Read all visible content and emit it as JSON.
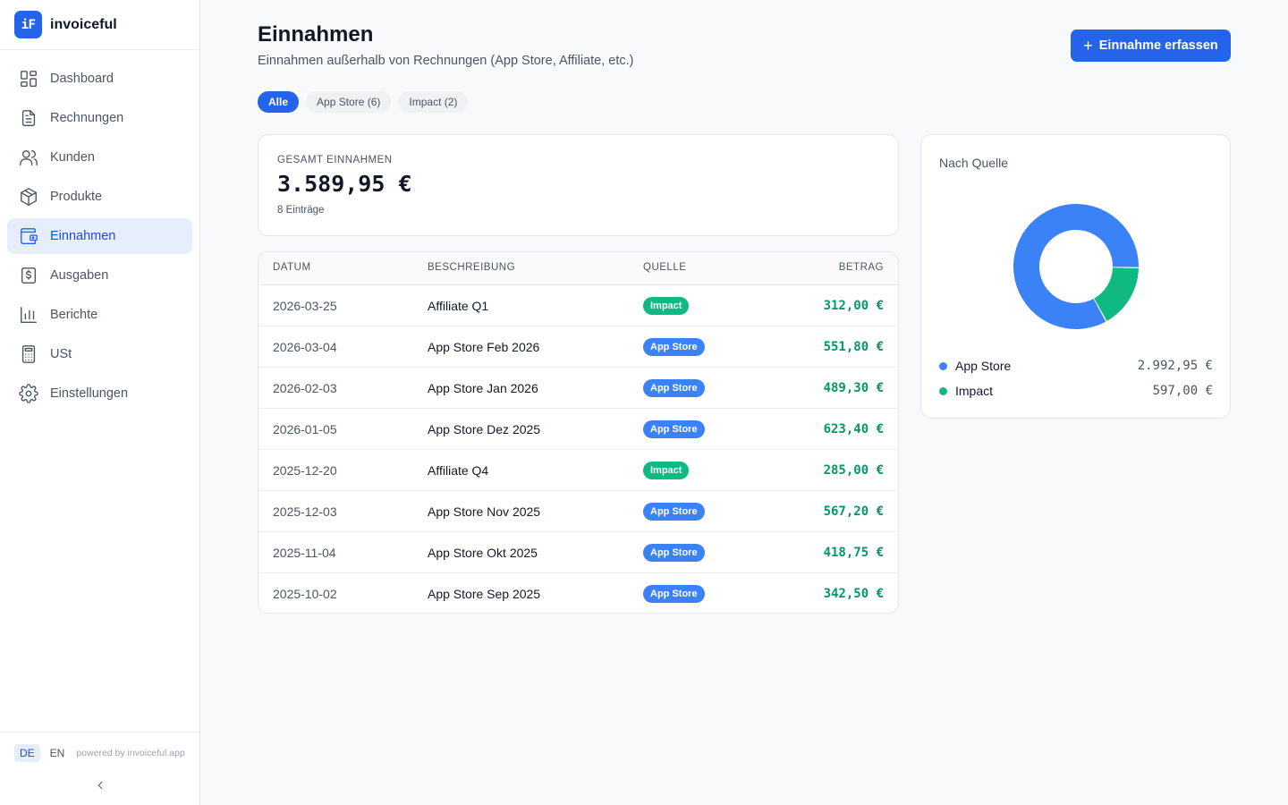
{
  "brand": {
    "logo": "iF",
    "name": "invoiceful"
  },
  "nav": [
    {
      "label": "Dashboard",
      "icon": "dashboard-icon",
      "active": false
    },
    {
      "label": "Rechnungen",
      "icon": "document-icon",
      "active": false
    },
    {
      "label": "Kunden",
      "icon": "users-icon",
      "active": false
    },
    {
      "label": "Produkte",
      "icon": "box-icon",
      "active": false
    },
    {
      "label": "Einnahmen",
      "icon": "wallet-icon",
      "active": true
    },
    {
      "label": "Ausgaben",
      "icon": "receipt-dollar-icon",
      "active": false
    },
    {
      "label": "Berichte",
      "icon": "bar-chart-icon",
      "active": false
    },
    {
      "label": "USt",
      "icon": "calculator-icon",
      "active": false
    },
    {
      "label": "Einstellungen",
      "icon": "gear-icon",
      "active": false
    }
  ],
  "footer": {
    "lang_de": "DE",
    "lang_en": "EN",
    "active_lang": "DE",
    "powered": "powered by invoiceful.app"
  },
  "header": {
    "title": "Einnahmen",
    "subtitle": "Einnahmen außerhalb von Rechnungen (App Store, Affiliate, etc.)",
    "add_button_plus": "+",
    "add_button": "Einnahme erfassen"
  },
  "filters": [
    {
      "label": "Alle",
      "active": true
    },
    {
      "label": "App Store (6)",
      "active": false
    },
    {
      "label": "Impact (2)",
      "active": false
    }
  ],
  "summary": {
    "label": "GESAMT EINNAHMEN",
    "value": "3.589,95 €",
    "count": "8 Einträge"
  },
  "table": {
    "headers": {
      "date": "DATUM",
      "description": "BESCHREIBUNG",
      "source": "QUELLE",
      "amount": "BETRAG"
    },
    "rows": [
      {
        "date": "2026-03-25",
        "description": "Affiliate Q1",
        "source": "Impact",
        "amount": "312,00 €"
      },
      {
        "date": "2026-03-04",
        "description": "App Store Feb 2026",
        "source": "App Store",
        "amount": "551,80 €"
      },
      {
        "date": "2026-02-03",
        "description": "App Store Jan 2026",
        "source": "App Store",
        "amount": "489,30 €"
      },
      {
        "date": "2026-01-05",
        "description": "App Store Dez 2025",
        "source": "App Store",
        "amount": "623,40 €"
      },
      {
        "date": "2025-12-20",
        "description": "Affiliate Q4",
        "source": "Impact",
        "amount": "285,00 €"
      },
      {
        "date": "2025-12-03",
        "description": "App Store Nov 2025",
        "source": "App Store",
        "amount": "567,20 €"
      },
      {
        "date": "2025-11-04",
        "description": "App Store Okt 2025",
        "source": "App Store",
        "amount": "418,75 €"
      },
      {
        "date": "2025-10-02",
        "description": "App Store Sep 2025",
        "source": "App Store",
        "amount": "342,50 €"
      }
    ]
  },
  "source_chart": {
    "title": "Nach Quelle",
    "items": [
      {
        "name": "App Store",
        "value": 2992.95,
        "display": "2.992,95 €",
        "color": "#3b82f6"
      },
      {
        "name": "Impact",
        "value": 597.0,
        "display": "597,00 €",
        "color": "#10b981"
      }
    ]
  },
  "colors": {
    "accent": "#2563eb",
    "app_store": "#3b82f6",
    "impact": "#10b981",
    "amount": "#059669"
  }
}
